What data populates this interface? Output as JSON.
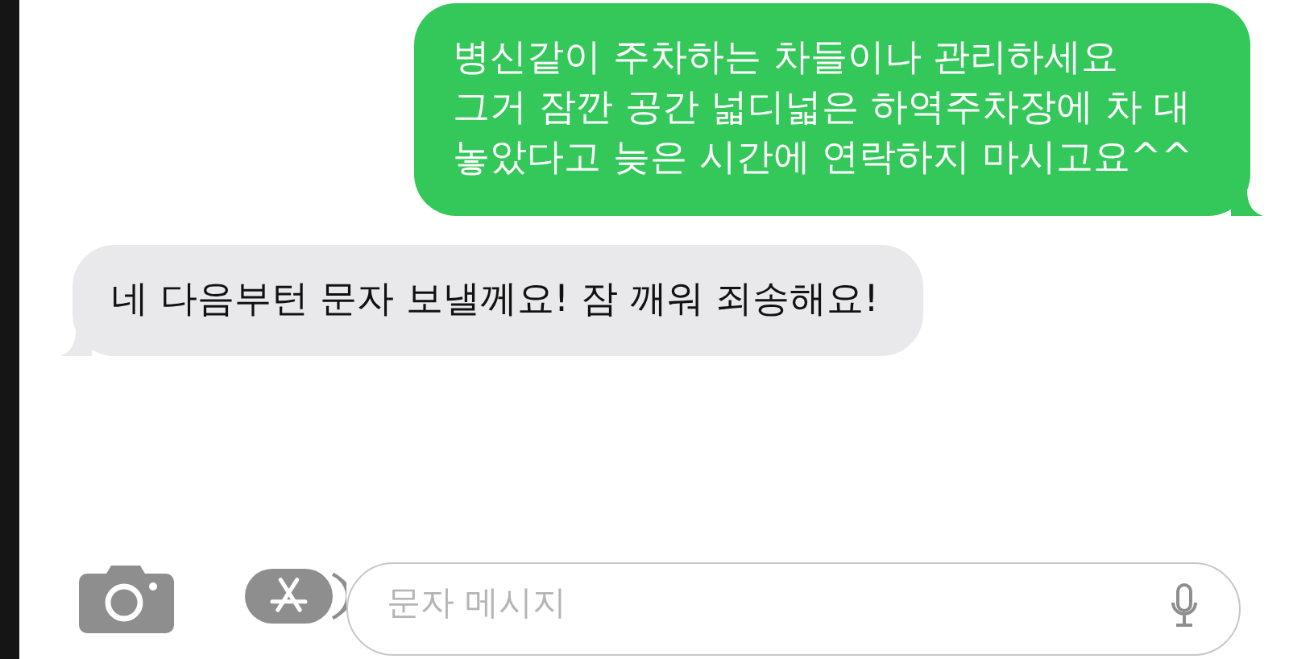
{
  "messages": [
    {
      "kind": "sent",
      "lines": [
        "병신같이 주차하는 차들이나 관리하세요",
        "그거 잠깐 공간 넓디넓은 하역주차장에 차 대",
        "놓았다고 늦은 시간에 연락하지 마시고요^^"
      ]
    },
    {
      "kind": "received",
      "lines": [
        "네 다음부턴 문자 보낼께요! 잠 깨워 죄송해요!"
      ]
    }
  ],
  "compose": {
    "placeholder": "문자 메시지"
  }
}
